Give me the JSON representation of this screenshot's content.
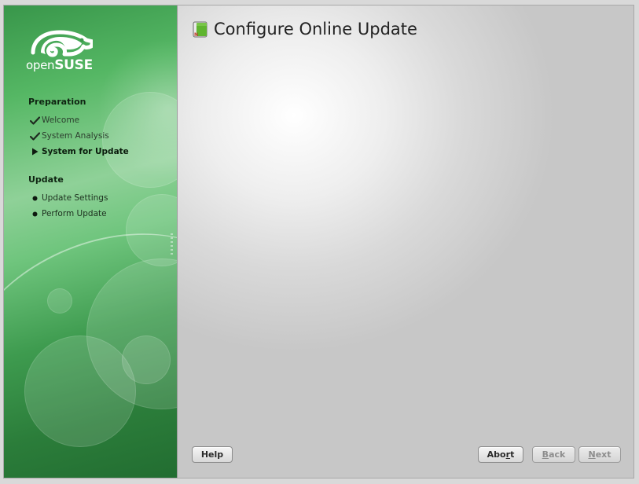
{
  "window": {
    "title": "Configure Online Update"
  },
  "brand": {
    "logo_prefix": "open",
    "logo_suffix": "SUSE",
    "accent_green": "#4fae5f",
    "logo_icon": "chameleon-icon"
  },
  "sidebar": {
    "sections": [
      {
        "title": "Preparation",
        "steps": [
          {
            "label": "Welcome",
            "state": "done",
            "icon": "check-icon"
          },
          {
            "label": "System Analysis",
            "state": "done",
            "icon": "check-icon"
          },
          {
            "label": "System for Update",
            "state": "current",
            "icon": "arrow-right-icon"
          }
        ]
      },
      {
        "title": "Update",
        "steps": [
          {
            "label": "Update Settings",
            "state": "pending",
            "icon": "bullet-icon"
          },
          {
            "label": "Perform Update",
            "state": "pending",
            "icon": "bullet-icon"
          }
        ]
      }
    ]
  },
  "main": {
    "title_icon": "online-update-icon"
  },
  "buttons": {
    "help": {
      "label": "Help",
      "enabled": true
    },
    "abort": {
      "pre": "Abo",
      "mnemonic": "r",
      "post": "t",
      "enabled": true
    },
    "back": {
      "pre": "",
      "mnemonic": "B",
      "post": "ack",
      "enabled": false
    },
    "next": {
      "pre": "",
      "mnemonic": "N",
      "post": "ext",
      "enabled": false
    }
  }
}
